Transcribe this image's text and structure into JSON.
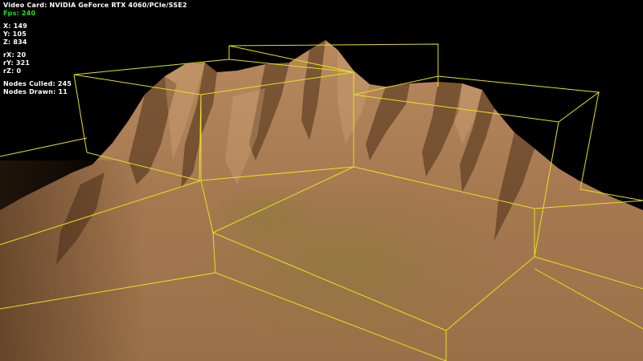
{
  "hud": {
    "video_card": "Video Card: NVIDIA GeForce RTX 4060/PCIe/SSE2",
    "fps": "Fps: 240",
    "x": "X: 149",
    "y": "Y: 105",
    "z": "Z: 834",
    "rx": "rX: 20",
    "ry": "rY: 321",
    "rz": "rZ: 0",
    "nodes_culled": "Nodes Culled: 245",
    "nodes_drawn": "Nodes Drawn: 11"
  },
  "scene": {
    "background_color": "#000000",
    "terrain_color": "#a87a52",
    "terrain_shadow_color": "#5a3c22",
    "terrain_highlight_color": "#d4a87c",
    "vegetation_tint_color": "#8a7a3a",
    "bounding_box_color": "#e6e21a",
    "fps_color": "#18e818"
  }
}
